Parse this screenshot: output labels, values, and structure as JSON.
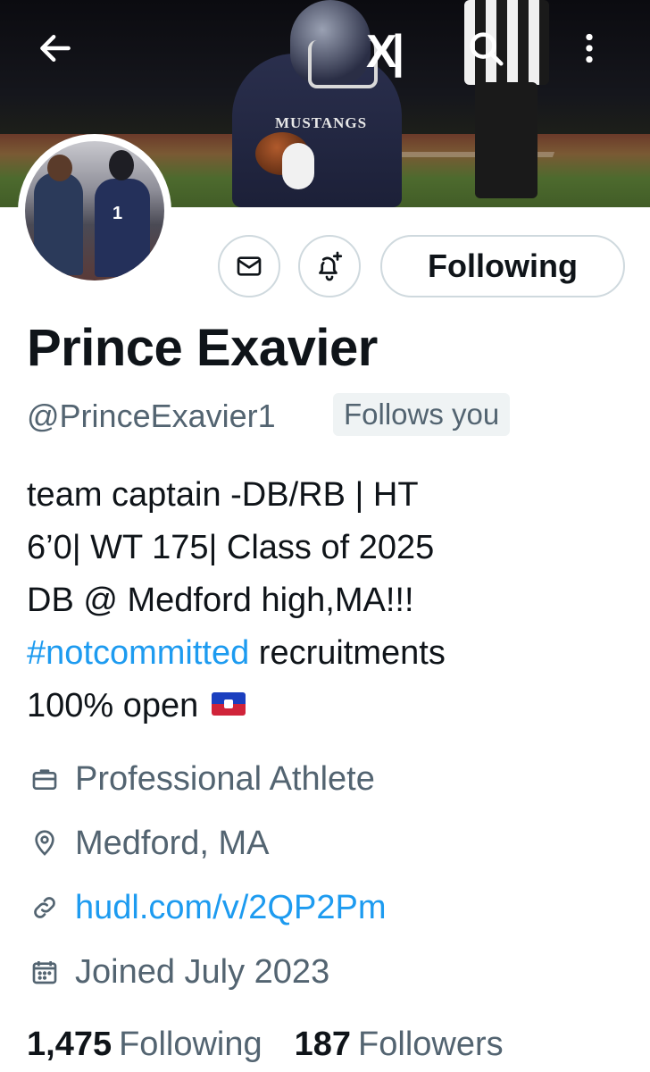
{
  "header": {
    "back_icon": "arrow-left-icon",
    "logo_icon": "x-logo-icon",
    "search_icon": "search-icon",
    "more_icon": "more-vertical-icon",
    "banner_jersey_text": "MUSTANGS"
  },
  "actions": {
    "message_icon": "envelope-icon",
    "notify_icon": "bell-plus-icon",
    "follow_label": "Following"
  },
  "profile": {
    "name": "Prince Exavier",
    "handle": "@PrinceExavier1",
    "follows_you": "Follows you",
    "bio_line1": "team captain -DB/RB | HT",
    "bio_line2": "6’0| WT 175| Class of 2025",
    "bio_line3": "DB @ Medford high,MA!!!",
    "bio_hashtag": "#notcommitted",
    "bio_line4_rest": " recruitments",
    "bio_line5": "100% open"
  },
  "meta": {
    "category": "Professional Athlete",
    "location": "Medford, MA",
    "link": "hudl.com/v/2QP2Pm",
    "joined": "Joined July 2023"
  },
  "stats": {
    "following_count": "1,475",
    "following_label": "Following",
    "followers_count": "187",
    "followers_label": "Followers"
  },
  "colors": {
    "text": "#0f1419",
    "secondary": "#536471",
    "link": "#1d9bf0",
    "border": "#cfd9de"
  }
}
